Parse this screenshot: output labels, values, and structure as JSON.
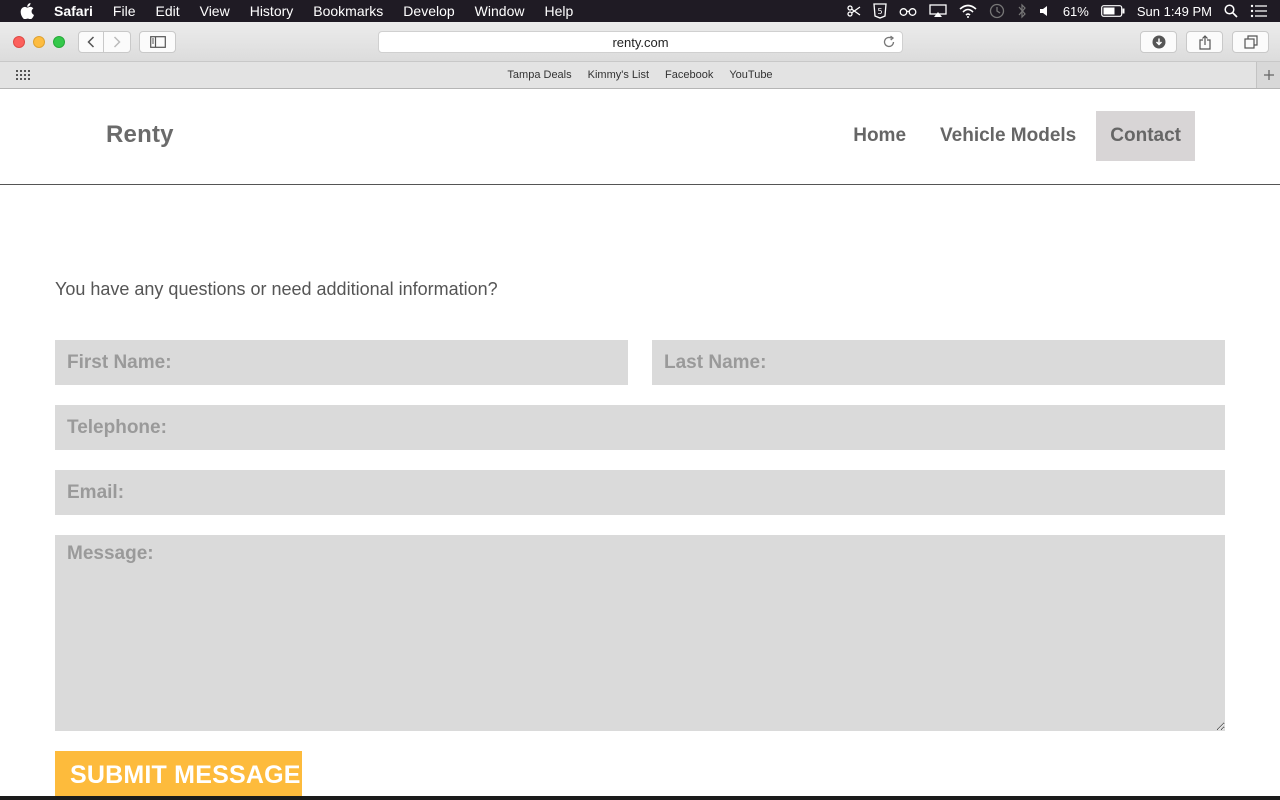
{
  "menubar": {
    "app_name": "Safari",
    "items": [
      "File",
      "Edit",
      "View",
      "History",
      "Bookmarks",
      "Develop",
      "Window",
      "Help"
    ],
    "battery_percent": "61%",
    "clock": "Sun 1:49 PM"
  },
  "browser": {
    "url": "renty.com",
    "favorites": [
      "Tampa Deals",
      "Kimmy's List",
      "Facebook",
      "YouTube"
    ]
  },
  "site": {
    "logo": "Renty",
    "nav": [
      {
        "label": "Home",
        "active": false
      },
      {
        "label": "Vehicle Models",
        "active": false
      },
      {
        "label": "Contact",
        "active": true
      }
    ]
  },
  "form": {
    "intro": "You have any questions or need additional information?",
    "first_name_placeholder": "First Name:",
    "last_name_placeholder": "Last Name:",
    "telephone_placeholder": "Telephone:",
    "email_placeholder": "Email:",
    "message_placeholder": "Message:",
    "submit_label": "SUBMIT MESSAGE"
  },
  "colors": {
    "accent_button": "#fdbb3c",
    "field_bg": "#dadada",
    "active_nav_bg": "#d8d5d6"
  }
}
